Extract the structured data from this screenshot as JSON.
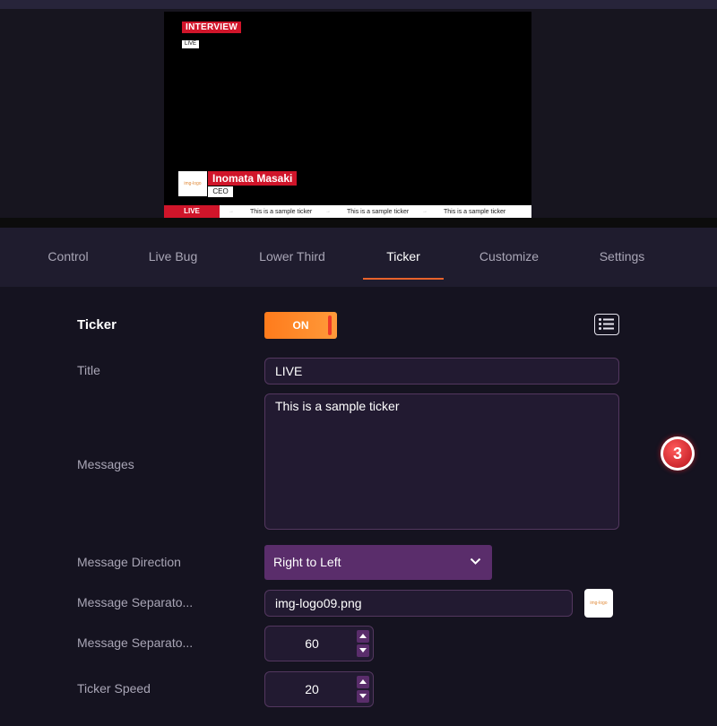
{
  "preview": {
    "live_bug": {
      "title": "INTERVIEW",
      "subtitle": "LIVE"
    },
    "lower_third": {
      "logo_text": "img-logo",
      "name": "Inomata Masaki",
      "title": "CEO"
    },
    "ticker": {
      "label": "LIVE",
      "messages": [
        "This is a sample ticker",
        "This is a sample ticker",
        "This is a sample ticker"
      ],
      "separator": "→"
    }
  },
  "tabs": [
    {
      "label": "Control"
    },
    {
      "label": "Live Bug"
    },
    {
      "label": "Lower Third"
    },
    {
      "label": "Ticker",
      "active": true
    },
    {
      "label": "Customize"
    },
    {
      "label": "Settings"
    }
  ],
  "form": {
    "ticker_label": "Ticker",
    "toggle_label": "ON",
    "title_label": "Title",
    "title_value": "LIVE",
    "messages_label": "Messages",
    "messages_value": "This is a sample ticker",
    "direction_label": "Message Direction",
    "direction_value": "Right to Left",
    "separator_image_label": "Message Separato...",
    "separator_image_value": "img-logo09.png",
    "separator_size_label": "Message Separato...",
    "separator_size_value": "60",
    "speed_label": "Ticker Speed",
    "speed_value": "20"
  },
  "annotation": {
    "step": "3"
  },
  "colors": {
    "accent_orange": "#ff8a2a",
    "live_red": "#d0152a",
    "select_purple": "#5a2d6b",
    "background": "#151320"
  },
  "icons": {
    "list": "list-icon",
    "chevron": "chevron-down-icon",
    "spin_up": "caret-up-icon",
    "spin_down": "caret-down-icon"
  }
}
